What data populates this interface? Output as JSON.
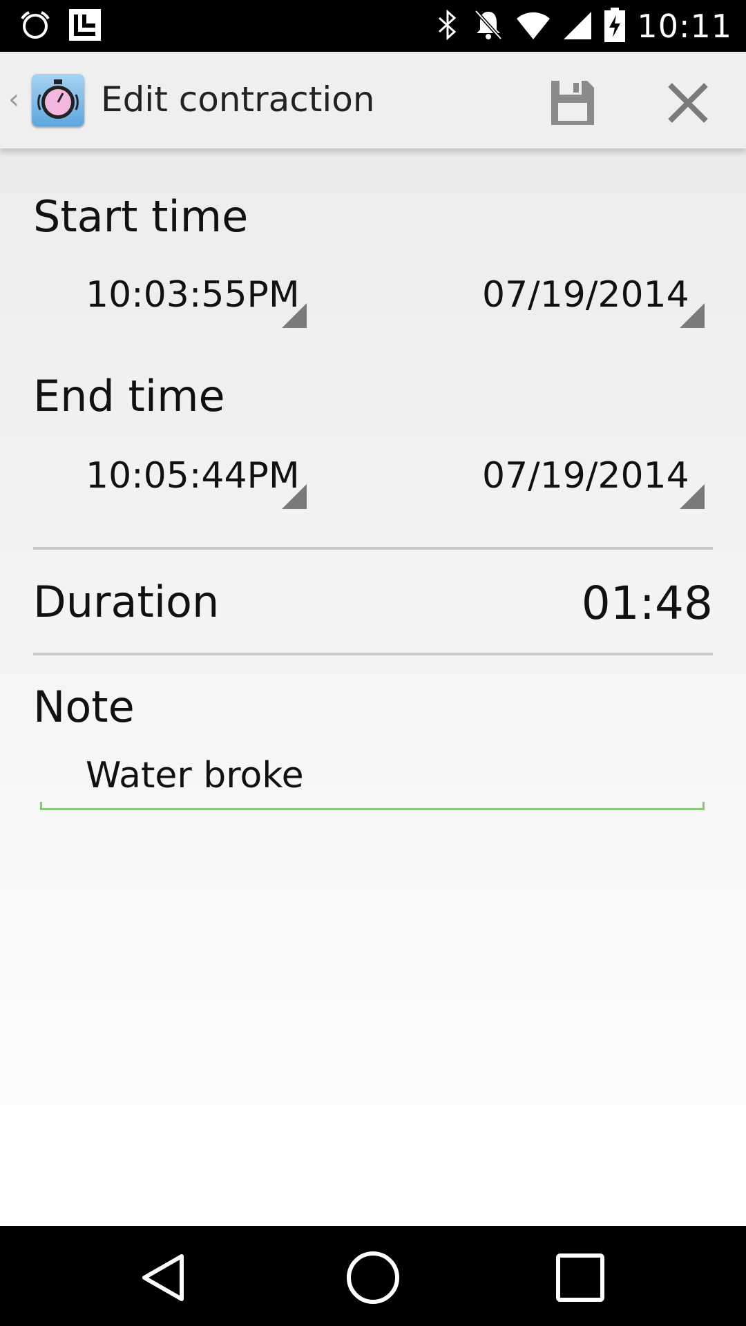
{
  "status_bar": {
    "time": "10:11",
    "icons": [
      "alarm-icon",
      "launcher-l-icon",
      "bluetooth-icon",
      "notifications-off-icon",
      "wifi-icon",
      "signal-icon",
      "battery-charging-icon"
    ]
  },
  "action_bar": {
    "title": "Edit contraction",
    "up_caret": "‹",
    "icons": [
      "stopwatch-app-icon",
      "save-icon",
      "close-icon"
    ]
  },
  "form": {
    "start_time_label": "Start time",
    "start_time_value": "10:03:55PM",
    "start_date_value": "07/19/2014",
    "end_time_label": "End time",
    "end_time_value": "10:05:44PM",
    "end_date_value": "07/19/2014",
    "duration_label": "Duration",
    "duration_value": "01:48",
    "note_label": "Note",
    "note_value": "Water broke",
    "accent_color": "#86c77a"
  },
  "nav_bar": {
    "icons": [
      "back-icon",
      "home-icon",
      "recents-icon"
    ]
  }
}
